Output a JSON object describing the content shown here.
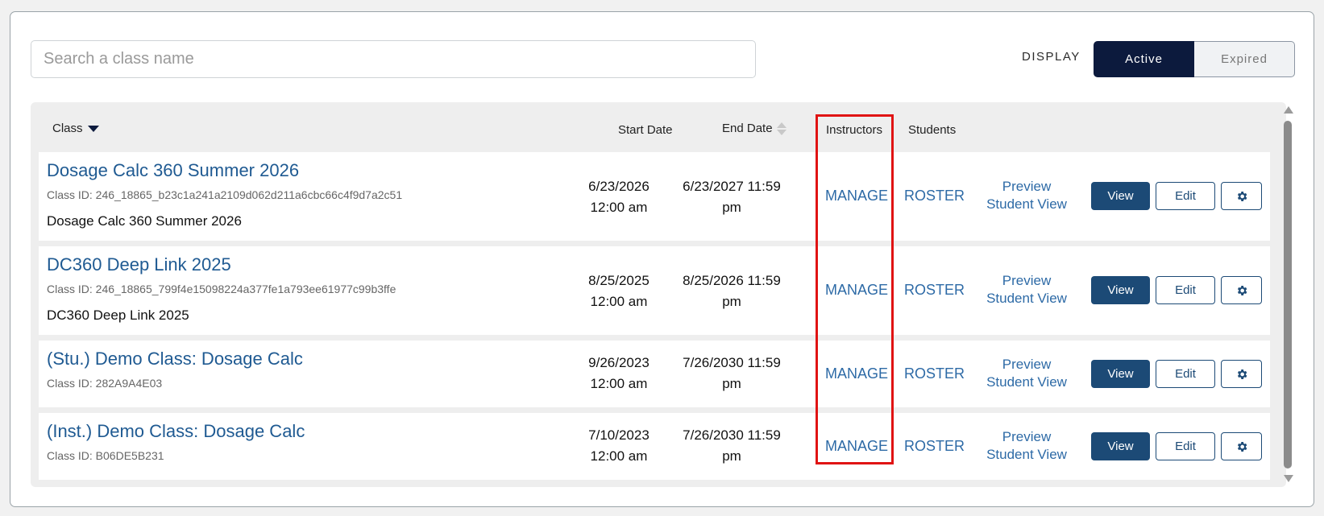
{
  "search": {
    "placeholder": "Search a class name"
  },
  "display": {
    "label": "DISPLAY",
    "options": [
      "Active",
      "Expired"
    ],
    "selected": "Active"
  },
  "columns": {
    "class": "Class",
    "start_date": "Start Date",
    "end_date": "End Date",
    "instructors": "Instructors",
    "students": "Students"
  },
  "rows": [
    {
      "name": "Dosage Calc 360 Summer 2026",
      "class_id": "Class ID: 246_18865_b23c1a241a2109d062d211a6cbc66c4f9d7a2c51",
      "description": "Dosage Calc 360 Summer 2026",
      "start_date": "6/23/2026",
      "start_time": "12:00 am",
      "end_date": "6/23/2027 11:59",
      "end_time": "pm",
      "instructors": "MANAGE",
      "students": "ROSTER",
      "preview_1": "Preview",
      "preview_2": "Student View",
      "view": "View",
      "edit": "Edit"
    },
    {
      "name": "DC360 Deep Link 2025",
      "class_id": "Class ID: 246_18865_799f4e15098224a377fe1a793ee61977c99b3ffe",
      "description": "DC360 Deep Link 2025",
      "start_date": "8/25/2025",
      "start_time": "12:00 am",
      "end_date": "8/25/2026 11:59",
      "end_time": "pm",
      "instructors": "MANAGE",
      "students": "ROSTER",
      "preview_1": "Preview",
      "preview_2": "Student View",
      "view": "View",
      "edit": "Edit"
    },
    {
      "name": "(Stu.) Demo Class: Dosage Calc",
      "class_id": "Class ID: 282A9A4E03",
      "description": "",
      "start_date": "9/26/2023",
      "start_time": "12:00 am",
      "end_date": "7/26/2030 11:59",
      "end_time": "pm",
      "instructors": "MANAGE",
      "students": "ROSTER",
      "preview_1": "Preview",
      "preview_2": "Student View",
      "view": "View",
      "edit": "Edit"
    },
    {
      "name": "(Inst.) Demo Class: Dosage Calc",
      "class_id": "Class ID: B06DE5B231",
      "description": "",
      "start_date": "7/10/2023",
      "start_time": "12:00 am",
      "end_date": "7/26/2030 11:59",
      "end_time": "pm",
      "instructors": "MANAGE",
      "students": "ROSTER",
      "preview_1": "Preview",
      "preview_2": "Student View",
      "view": "View",
      "edit": "Edit"
    }
  ],
  "colors": {
    "brand_dark": "#0c1a3d",
    "link": "#2d6aa6",
    "button": "#1c4a76",
    "highlight": "#e01313"
  }
}
